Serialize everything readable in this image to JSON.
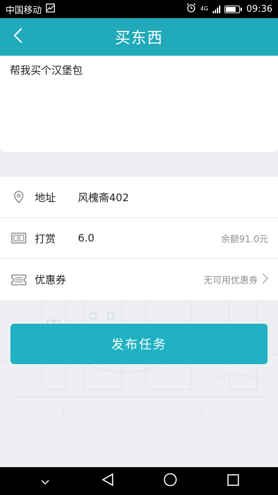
{
  "status_bar": {
    "carrier": "中国移动",
    "network": "4G",
    "time": "09:36"
  },
  "header": {
    "title": "买东西",
    "back_icon": "chevron-left-icon"
  },
  "request": {
    "text": "帮我买个汉堡包"
  },
  "form": {
    "address": {
      "label": "地址",
      "value": "风槐斋402",
      "icon": "location-pin-icon"
    },
    "reward": {
      "label": "打赏",
      "value": "6.0",
      "balance": "余额91.0元",
      "icon": "cash-icon"
    },
    "coupon": {
      "label": "优惠券",
      "status": "无可用优惠券",
      "icon": "ticket-icon"
    }
  },
  "submit": {
    "label": "发布任务"
  },
  "colors": {
    "accent": "#21aab9",
    "button": "#20b2c2",
    "background": "#eeeff3"
  }
}
